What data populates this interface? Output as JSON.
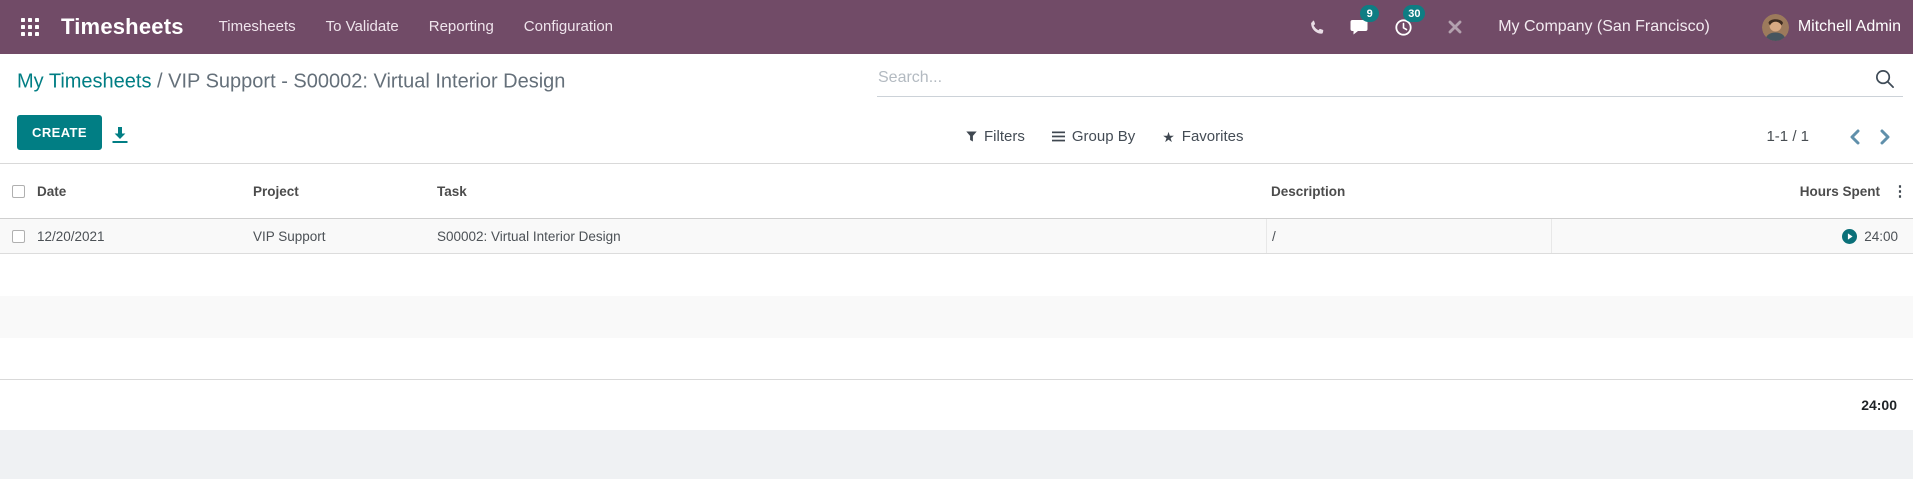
{
  "navbar": {
    "brand": "Timesheets",
    "menus": [
      {
        "label": "Timesheets"
      },
      {
        "label": "To Validate"
      },
      {
        "label": "Reporting"
      },
      {
        "label": "Configuration"
      }
    ],
    "systray": {
      "messages_badge": "9",
      "activities_badge": "30",
      "company": "My Company (San Francisco)",
      "user": "Mitchell Admin"
    }
  },
  "control_panel": {
    "breadcrumb": {
      "parent": "My Timesheets",
      "separator": " / ",
      "current": "VIP Support - S00002: Virtual Interior Design"
    },
    "search": {
      "placeholder": "Search..."
    },
    "create_label": "CREATE",
    "filters_label": "Filters",
    "group_by_label": "Group By",
    "favorites_label": "Favorites",
    "favorites_star": "★",
    "pager": {
      "text": "1-1 / 1"
    }
  },
  "table": {
    "columns": [
      "Date",
      "Project",
      "Task",
      "Description",
      "Hours Spent"
    ],
    "column_options_glyph": "⋮",
    "rows": [
      {
        "date": "12/20/2021",
        "project": "VIP Support",
        "task": "S00002: Virtual Interior Design",
        "description": "/",
        "hours": "24:00"
      }
    ],
    "total_hours": "24:00"
  },
  "icons": {
    "apps": "grid-3x3",
    "phone": "phone-receiver",
    "messages": "chat-bubble",
    "activities": "clock",
    "dev_tools": "crossed-tools",
    "search": "magnifier",
    "export": "download-tray",
    "filter": "funnel",
    "group_by": "triple-bars",
    "favorites": "star",
    "pager_prev": "chevron-left",
    "pager_next": "chevron-right",
    "timer": "play-circle",
    "column_options": "vertical-ellipsis"
  },
  "colors": {
    "navbar": "#714B67",
    "accent": "#017e84",
    "badge": "#0e7d83",
    "row_stripe": "#f9f9f9"
  }
}
